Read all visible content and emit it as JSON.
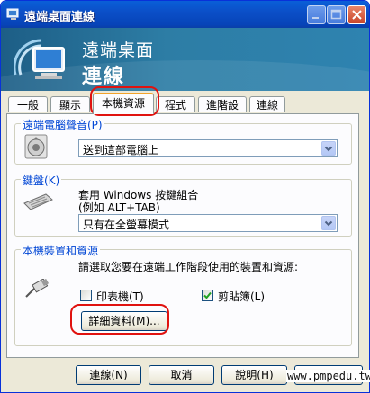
{
  "window": {
    "title": "遠端桌面連線"
  },
  "banner": {
    "line1": "遠端桌面",
    "line2": "連線"
  },
  "tabs": [
    {
      "label": "一般"
    },
    {
      "label": "顯示"
    },
    {
      "label": "本機資源"
    },
    {
      "label": "程式集"
    },
    {
      "label": "進階設定"
    },
    {
      "label": "連線"
    }
  ],
  "active_tab": "本機資源",
  "sound": {
    "group_label": "遠端電腦聲音(P)",
    "value": "送到這部電腦上"
  },
  "keyboard": {
    "group_label": "鍵盤(K)",
    "description_line1": "套用 Windows 按鍵組合",
    "description_line2": "(例如 ALT+TAB)",
    "value": "只有在全螢幕模式"
  },
  "local_devices": {
    "group_label": "本機裝置和資源",
    "description": "請選取您要在遠端工作階段使用的裝置和資源:",
    "printers_label": "印表機(T)",
    "printers_checked": false,
    "clipboard_label": "剪貼簿(L)",
    "clipboard_checked": true,
    "details_button": "詳細資料(M)..."
  },
  "footer": {
    "connect": "連線(N)",
    "cancel": "取消",
    "help": "說明(H)",
    "options": "選項(O) <<"
  },
  "watermark": "www.pmpedu.tw",
  "colors": {
    "accent": "#0046d5",
    "highlight": "#e0120f",
    "titlebar": "#0a5fd8"
  }
}
